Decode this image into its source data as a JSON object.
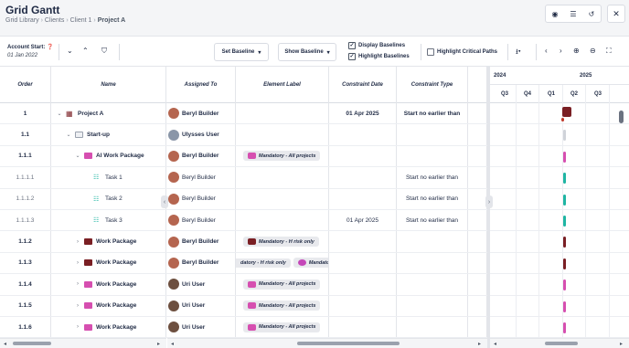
{
  "header": {
    "title": "Grid Gantt",
    "breadcrumb": [
      "Grid Library",
      "Clients",
      "Client 1",
      "Project A"
    ],
    "icons": [
      "eye-icon",
      "list-icon",
      "undo-icon"
    ],
    "close_icon": "close-icon"
  },
  "toolbar": {
    "account_start_label": "Account Start:",
    "account_start_date": "01 Jan 2022",
    "set_baseline": "Set Baseline",
    "show_baseline": "Show Baseline",
    "display_baselines": "Display Baselines",
    "highlight_baselines": "Highlight Baselines",
    "highlight_critical_paths": "Highlight Critical Paths",
    "display_baselines_checked": true,
    "highlight_baselines_checked": true,
    "highlight_critical_checked": false
  },
  "columns": {
    "order": "Order",
    "name": "Name",
    "assigned_to": "Assigned To",
    "element_label": "Element Label",
    "constraint_date": "Constraint Date",
    "constraint_type": "Constraint Type"
  },
  "rows": [
    {
      "order": "1",
      "name": "Project A",
      "assigned": "Beryl Builder",
      "labels": [],
      "cdate": "01 Apr 2025",
      "ctype": "Start no earlier than",
      "bold": true,
      "chev": "⌄",
      "icon": "project-icon",
      "indent": 0,
      "ctype_bold": true,
      "cdate_bold": true
    },
    {
      "order": "1.1",
      "name": "Start-up",
      "assigned": "Ulysses User",
      "labels": [],
      "cdate": "",
      "ctype": "",
      "bold": true,
      "chev": "⌄",
      "icon": "folder-icon",
      "indent": 1
    },
    {
      "order": "1.1.1",
      "name": "AI Work Package",
      "assigned": "Beryl Builder",
      "labels": [
        {
          "text": "Mandatory - All projects",
          "color": "#d64fb0"
        }
      ],
      "cdate": "",
      "ctype": "",
      "bold": true,
      "chev": "⌄",
      "icon": "package-icon",
      "indent": 2
    },
    {
      "order": "1.1.1.1",
      "name": "Task 1",
      "assigned": "Beryl Builder",
      "labels": [],
      "cdate": "",
      "ctype": "Start no earlier than",
      "bold": false,
      "chev": "",
      "icon": "task-icon",
      "indent": 3
    },
    {
      "order": "1.1.1.2",
      "name": "Task 2",
      "assigned": "Beryl Builder",
      "labels": [],
      "cdate": "",
      "ctype": "Start no earlier than",
      "bold": false,
      "chev": "",
      "icon": "task-icon",
      "indent": 3
    },
    {
      "order": "1.1.1.3",
      "name": "Task 3",
      "assigned": "Beryl Builder",
      "labels": [],
      "cdate": "01 Apr 2025",
      "ctype": "Start no earlier than",
      "bold": false,
      "chev": "",
      "icon": "task-icon",
      "indent": 3
    },
    {
      "order": "1.1.2",
      "name": "Work Package",
      "assigned": "Beryl Builder",
      "labels": [
        {
          "text": "Mandatory - H risk only",
          "color": "#7a1f24"
        }
      ],
      "cdate": "",
      "ctype": "",
      "bold": true,
      "chev": "›",
      "icon": "package-red-icon",
      "indent": 2
    },
    {
      "order": "1.1.3",
      "name": "Work Package",
      "assigned": "Beryl Builder",
      "labels": [
        {
          "text": "datory - H risk only",
          "color": ""
        },
        {
          "text": "Mandatory -",
          "color": "#c446b8"
        }
      ],
      "cdate": "",
      "ctype": "",
      "bold": true,
      "chev": "›",
      "icon": "package-red-icon",
      "indent": 2
    },
    {
      "order": "1.1.4",
      "name": "Work Package",
      "assigned": "Uri User",
      "labels": [
        {
          "text": "Mandatory - All projects",
          "color": "#d64fb0"
        }
      ],
      "cdate": "",
      "ctype": "",
      "bold": true,
      "chev": "›",
      "icon": "package-icon",
      "indent": 2
    },
    {
      "order": "1.1.5",
      "name": "Work Package",
      "assigned": "Uri User",
      "labels": [
        {
          "text": "Mandatory - All projects",
          "color": "#d64fb0"
        }
      ],
      "cdate": "",
      "ctype": "",
      "bold": true,
      "chev": "›",
      "icon": "package-icon",
      "indent": 2
    },
    {
      "order": "1.1.6",
      "name": "Work Package",
      "assigned": "Uri User",
      "labels": [
        {
          "text": "Mandatory - All projects",
          "color": "#d64fb0"
        }
      ],
      "cdate": "",
      "ctype": "",
      "bold": true,
      "chev": "›",
      "icon": "package-icon",
      "indent": 2
    }
  ],
  "timeline": {
    "years": [
      {
        "label": "2024"
      },
      {
        "label": "2025"
      }
    ],
    "quarters": [
      "Q3",
      "Q4",
      "Q1",
      "Q2",
      "Q3"
    ],
    "bar_colors": [
      "#7a1f24",
      "#d0d3d9",
      "#d64fb0",
      "#1fb5a3",
      "#1fb5a3",
      "#1fb5a3",
      "#7a1f24",
      "#7a1f24",
      "#d64fb0",
      "#d64fb0",
      "#d64fb0"
    ]
  },
  "colors": {
    "project": "#7a1f24",
    "package": "#d64fb0",
    "task": "#1fb5a3"
  }
}
